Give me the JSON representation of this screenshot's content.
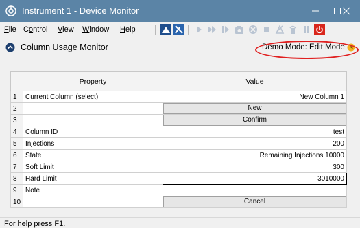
{
  "window": {
    "title": "Instrument 1 - Device Monitor",
    "icon": "instrument-logo-icon",
    "controls": [
      "minimize-icon",
      "maximize-icon",
      "close-icon"
    ]
  },
  "menu": {
    "file": {
      "first": "F",
      "rest": "ile"
    },
    "control": {
      "a": "C",
      "b": "o",
      "c": "ntrol"
    },
    "view": {
      "first": "V",
      "rest": "iew"
    },
    "window": {
      "first": "W",
      "rest": "indow"
    },
    "help": {
      "first": "H",
      "rest": "elp"
    }
  },
  "toolbar": {
    "icons": [
      "sample-icon",
      "run-method-icon",
      "play-icon",
      "fast-forward-icon",
      "step-icon",
      "snapshot-icon",
      "stop-sequence-icon",
      "stop-icon",
      "pump-icon",
      "vial-icon",
      "pause-icon",
      "power-icon"
    ]
  },
  "panel": {
    "title": "Column Usage Monitor",
    "mode": "Demo Mode: Edit Mode",
    "colors": {
      "accent_red": "#e02020",
      "lock_yellow": "#f2b01e",
      "titlebar": "#5b84a6"
    }
  },
  "grid": {
    "headers": {
      "property": "Property",
      "value": "Value"
    },
    "rows": [
      {
        "num": "1",
        "property": "Current Column (select)",
        "value": "New Column 1"
      },
      {
        "num": "2",
        "property": "",
        "button": "New"
      },
      {
        "num": "3",
        "property": "",
        "button": "Confirm"
      },
      {
        "num": "4",
        "property": "Column ID",
        "value": "test"
      },
      {
        "num": "5",
        "property": "Injections",
        "value": "200"
      },
      {
        "num": "6",
        "property": "State",
        "value": "Remaining Injections 10000"
      },
      {
        "num": "7",
        "property": "Soft Limit",
        "value": "300"
      },
      {
        "num": "8",
        "property": "Hard Limit",
        "value": "3010000"
      },
      {
        "num": "9",
        "property": "Note",
        "value": ""
      },
      {
        "num": "10",
        "property": "",
        "button": "Cancel"
      }
    ]
  },
  "status": {
    "text": "For help press F1."
  }
}
